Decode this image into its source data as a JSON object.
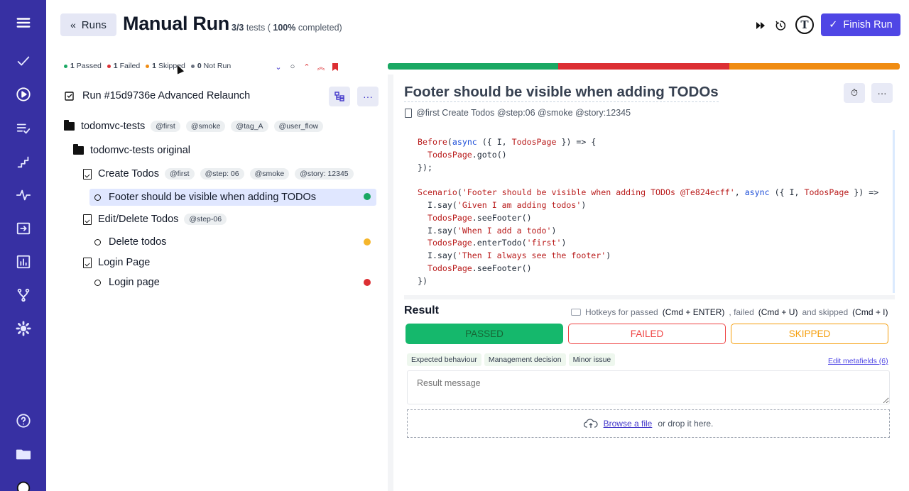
{
  "sidebar": {
    "icons": [
      "menu-icon",
      "checkmark-icon",
      "play-circle-icon",
      "list-check-icon",
      "steps-icon",
      "pulse-icon",
      "import-icon",
      "bar-chart-icon",
      "branch-icon",
      "gear-icon",
      "help-icon",
      "folder-icon",
      "logo-icon"
    ]
  },
  "header": {
    "runs_label": "Runs",
    "title": "Manual Run",
    "summary_count": "3/3",
    "summary_tests": "tests (",
    "summary_percent": "100%",
    "summary_completed": "completed)",
    "logo_letter": "T",
    "finish_label": "Finish Run"
  },
  "filters": {
    "passed_count": "1",
    "passed_label": "Passed",
    "failed_count": "1",
    "failed_label": "Failed",
    "skipped_count": "1",
    "skipped_label": "Skipped",
    "notrun_count": "0",
    "notrun_label": "Not Run"
  },
  "progress": [
    {
      "status": "passed",
      "color": "#1aa863",
      "fraction": 0.3333
    },
    {
      "status": "failed",
      "color": "#dc2f33",
      "fraction": 0.3333
    },
    {
      "status": "skipped",
      "color": "#f08c12",
      "fraction": 0.3334
    }
  ],
  "run": {
    "label": "Run #15d9736e Advanced Relaunch"
  },
  "tree": {
    "suite_root": "todomvc-tests",
    "suite_root_tags": [
      "@first",
      "@smoke",
      "@tag_A",
      "@user_flow"
    ],
    "suite_sub": "todomvc-tests original",
    "file1": "Create Todos",
    "file1_tags": [
      "@first",
      "@step: 06",
      "@smoke",
      "@story: 12345"
    ],
    "test1": "Footer should be visible when adding TODOs",
    "file2": "Edit/Delete Todos",
    "file2_tags": [
      "@step-06"
    ],
    "test2": "Delete todos",
    "file3": "Login Page",
    "test3": "Login page"
  },
  "status_colors": {
    "passed": "#1aa863",
    "skipped": "#f5b62b",
    "failed": "#dc2f33"
  },
  "test": {
    "title": "Footer should be visible when adding TODOs",
    "subline": "@first Create Todos @step:06 @smoke @story:12345"
  },
  "code": {
    "lines": [
      "Before(async ({ I, TodosPage }) => {",
      "  TodosPage.goto()",
      "});",
      "",
      "Scenario('Footer should be visible when adding TODOs @Te824ecff', async ({ I, TodosPage }) =>",
      "  I.say('Given I am adding todos')",
      "  TodosPage.seeFooter()",
      "  I.say('When I add a todo')",
      "  TodosPage.enterTodo('first')",
      "  I.say('Then I always see the footer')",
      "  TodosPage.seeFooter()",
      "})"
    ]
  },
  "result": {
    "label": "Result",
    "hotkeys_prefix": "Hotkeys for passed",
    "hk_pass": "(Cmd + ENTER)",
    "hk_sep1": ", failed",
    "hk_fail": "(Cmd + U)",
    "hk_sep2": "and skipped",
    "hk_skip": "(Cmd + I)",
    "passed_btn": "PASSED",
    "failed_btn": "FAILED",
    "skipped_btn": "SKIPPED",
    "chips": [
      "Expected behaviour",
      "Management decision",
      "Minor issue"
    ],
    "edit_meta": "Edit metafields (6)",
    "message_placeholder": "Result message",
    "browse_label": "Browse a file",
    "drop_label": "or drop it here."
  }
}
